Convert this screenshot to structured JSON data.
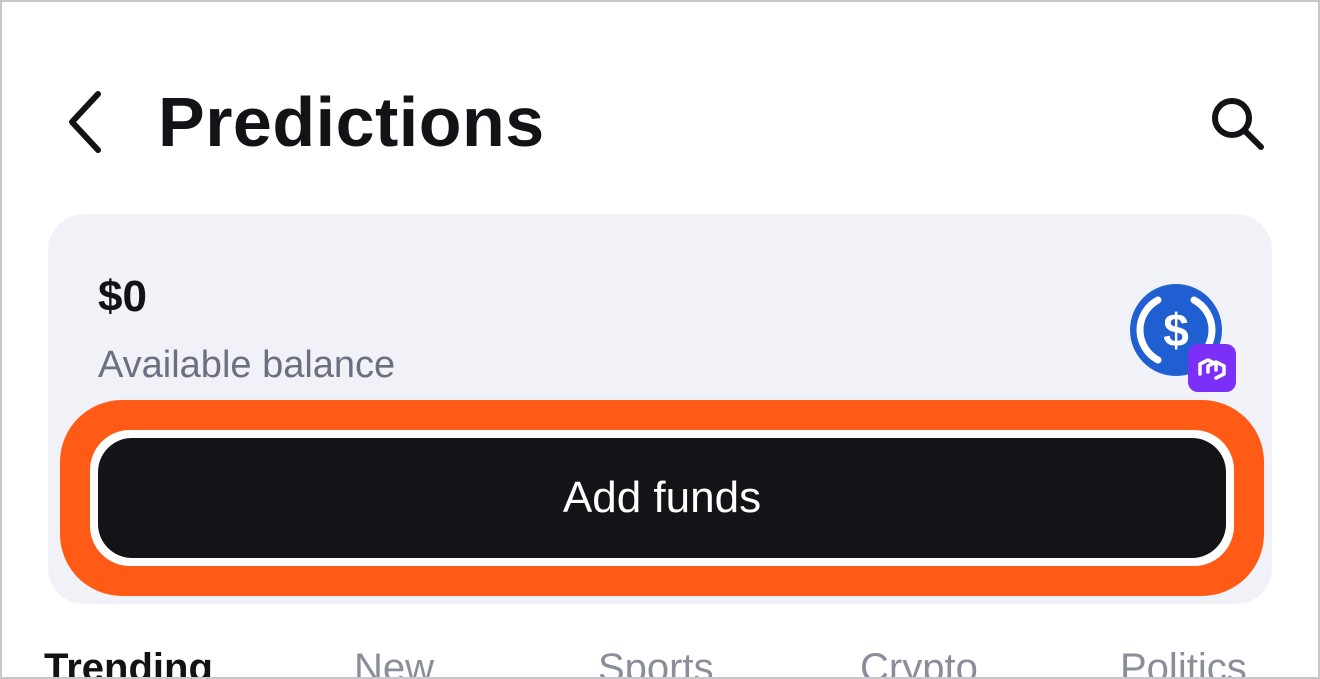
{
  "header": {
    "title": "Predictions",
    "back_icon": "chevron-left-icon",
    "search_icon": "search-icon"
  },
  "balance": {
    "amount": "$0",
    "label": "Available balance",
    "token_icon": "usdc-icon",
    "network_icon": "polygon-icon"
  },
  "actions": {
    "add_funds_label": "Add funds"
  },
  "tabs": [
    {
      "label": "Trending",
      "active": true
    },
    {
      "label": "New",
      "active": false
    },
    {
      "label": "Sports",
      "active": false
    },
    {
      "label": "Crypto",
      "active": false
    },
    {
      "label": "Politics",
      "active": false
    }
  ],
  "colors": {
    "highlight": "#ff5b16",
    "button_bg": "#131417",
    "card_bg": "#f1f2f7",
    "usdc_blue": "#1f5fd1",
    "polygon_purple": "#7b2ff7"
  }
}
